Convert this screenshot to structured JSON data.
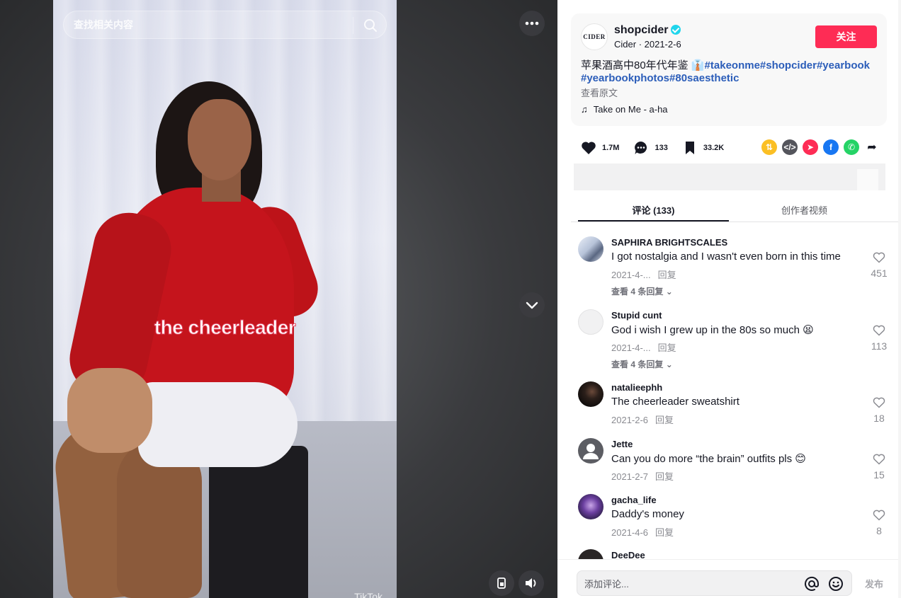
{
  "search": {
    "placeholder": "查找相关内容"
  },
  "video": {
    "caption": "the cheerleader",
    "watermark": "TikTok"
  },
  "post": {
    "author": "shopcider",
    "nickname": "Cider",
    "date": "2021-2-6",
    "avatar_text": "CIDER",
    "follow_label": "关注",
    "description_text": "苹果酒高中80年代年鉴 ",
    "hashtags": [
      "#takeonme",
      "#shopcider",
      "#yearbook",
      "#yearbookphotos",
      "#80saesthetic"
    ],
    "see_original": "查看原文",
    "music": "Take on Me - a-ha"
  },
  "stats": {
    "likes": "1.7M",
    "comments": "133",
    "saves": "33.2K"
  },
  "colors": {
    "accent": "#fe2c55",
    "hashtag": "#2b5db9"
  },
  "tabs": [
    {
      "label": "评论 (133)"
    },
    {
      "label": "创作者视频"
    }
  ],
  "comments": [
    {
      "user": "SAPHIRA BRIGHTSCALES",
      "text": "I got nostalgia and I wasn't even born in this time",
      "date": "2021-4-...",
      "reply": "回复",
      "likes": "451",
      "more": "查看 4 条回复"
    },
    {
      "user": "Stupid cunt",
      "text": "God i wish I grew up in the 80s so much 😫",
      "date": "2021-4-...",
      "reply": "回复",
      "likes": "113",
      "more": "查看 4 条回复"
    },
    {
      "user": "natalieephh",
      "text": "The cheerleader sweatshirt",
      "date": "2021-2-6",
      "reply": "回复",
      "likes": "18"
    },
    {
      "user": "Jette",
      "text": "Can you do more “the brain” outfits pls 😊",
      "date": "2021-2-7",
      "reply": "回复",
      "likes": "15"
    },
    {
      "user": "gacha_life",
      "text": "Daddy's money",
      "date": "2021-4-6",
      "reply": "回复",
      "likes": "8"
    },
    {
      "user": "DeeDee"
    }
  ],
  "composer": {
    "placeholder": "添加评论...",
    "post_label": "发布"
  }
}
